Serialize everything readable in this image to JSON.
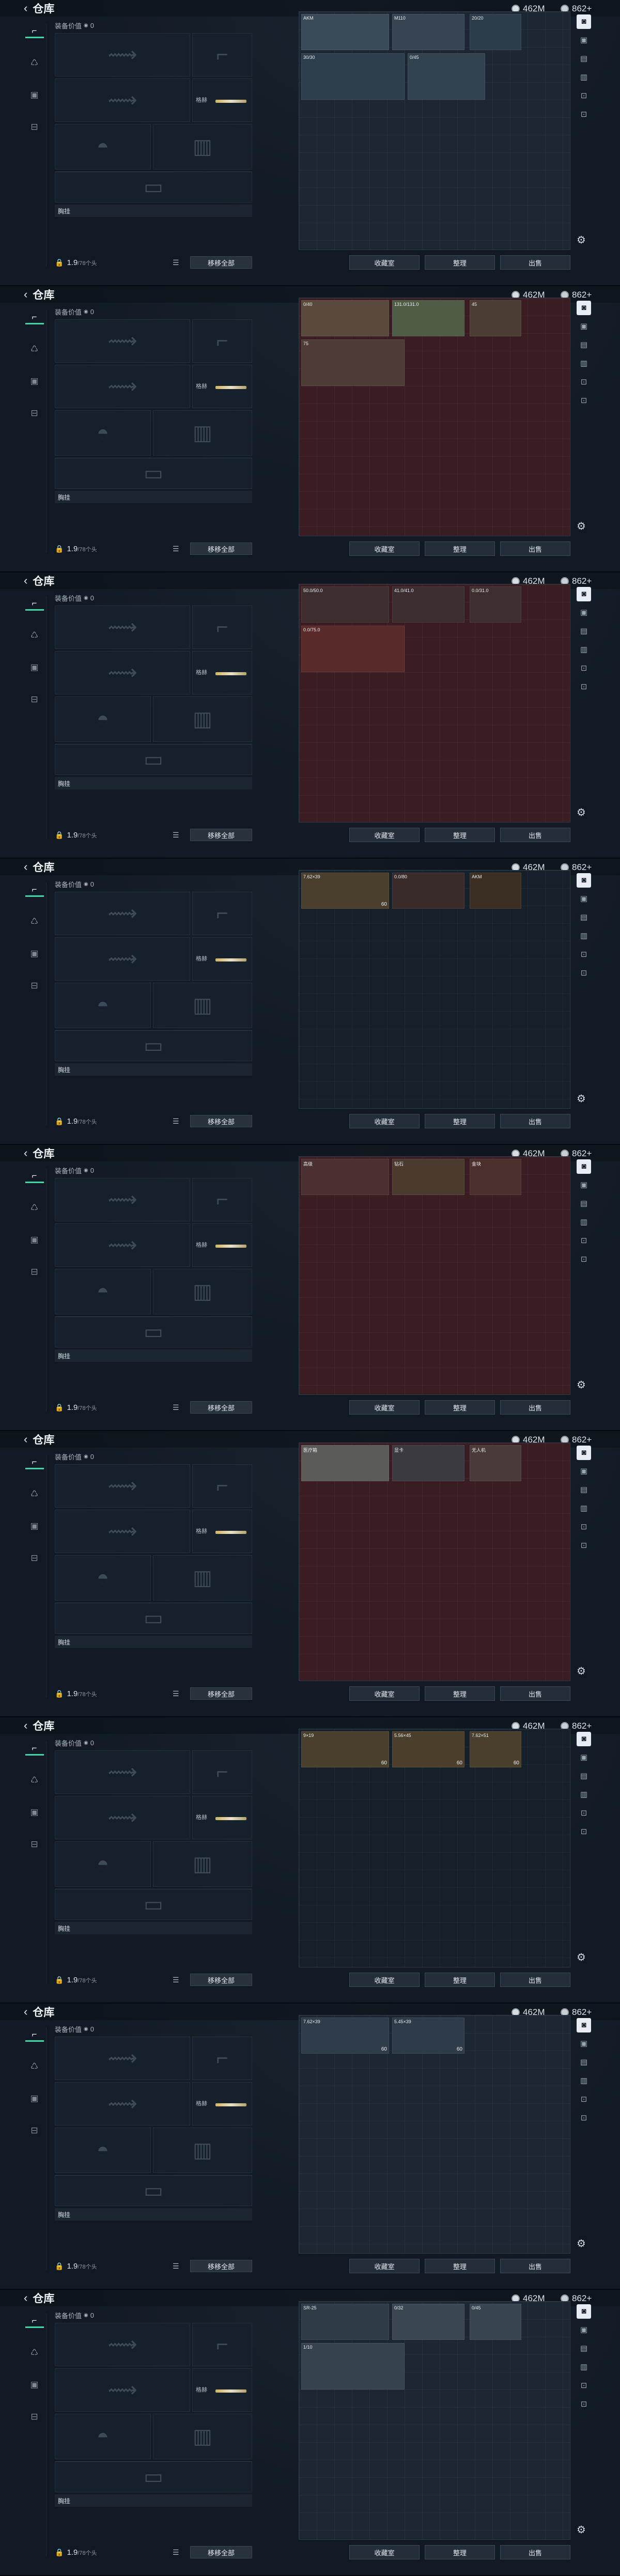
{
  "page": {
    "back_icon": "back-arrow-icon",
    "title": "仓库",
    "currency": [
      {
        "icon": "coin-icon",
        "value": "462M"
      },
      {
        "icon": "silver-icon",
        "value": "862+"
      }
    ],
    "loadout": {
      "equip_value_label": "装备价值",
      "equip_value": "0",
      "knife_label": "格赫",
      "pocket_label": "胸挂",
      "capacity_value": "1.9",
      "capacity_total": "/78个头",
      "remove_all_label": "移移全部"
    },
    "actions": [
      "收藏室",
      "整理",
      "出售"
    ],
    "hint": "收藏室"
  },
  "frames": [
    {
      "theme": "blue",
      "items": [
        {
          "label": "AKM",
          "count": "",
          "color": "#3a4a58"
        },
        {
          "label": "M110",
          "count": "",
          "color": "#374553"
        },
        {
          "label": "20/20",
          "count": "",
          "color": "#2c3c4a"
        },
        {
          "label": "30/30",
          "count": "",
          "color": "#2e3e4c"
        },
        {
          "label": "0/45",
          "count": "",
          "color": "#33424f"
        }
      ]
    },
    {
      "theme": "red",
      "items": [
        {
          "label": "0/40",
          "count": "",
          "color": "#5a4a3d"
        },
        {
          "label": "131.0/131.0",
          "count": "",
          "color": "#4e5b45"
        },
        {
          "label": "45",
          "count": "",
          "color": "#4b3c34"
        },
        {
          "label": "75",
          "count": "",
          "color": "#4d3b35"
        }
      ]
    },
    {
      "theme": "red",
      "items": [
        {
          "label": "50.0/50.0",
          "count": "",
          "color": "#3e2d2f"
        },
        {
          "label": "41.0/41.0",
          "count": "",
          "color": "#3c2d30"
        },
        {
          "label": "0.0/31.0",
          "count": "",
          "color": "#3f2e30"
        },
        {
          "label": "0.0/75.0",
          "count": "",
          "color": "#5a2a2a"
        }
      ]
    },
    {
      "theme": "dark",
      "items": [
        {
          "label": "7.62×39",
          "count": "60",
          "color": "#4a3f2c"
        },
        {
          "label": "0.0/80",
          "count": "",
          "color": "#3a2b2b"
        },
        {
          "label": "AKM",
          "count": "",
          "color": "#3b2f24"
        }
      ]
    },
    {
      "theme": "red",
      "items": [
        {
          "label": "高级",
          "count": "",
          "color": "#4a3030"
        },
        {
          "label": "钻石",
          "count": "",
          "color": "#4b3b2e"
        },
        {
          "label": "金块",
          "count": "",
          "color": "#4a2f2c"
        }
      ]
    },
    {
      "theme": "red",
      "items": [
        {
          "label": "医疗箱",
          "count": "",
          "color": "#5a5a58"
        },
        {
          "label": "显卡",
          "count": "",
          "color": "#3b3a40"
        },
        {
          "label": "无人机",
          "count": "",
          "color": "#4a3a3a"
        }
      ]
    },
    {
      "theme": "dark",
      "items": [
        {
          "label": "9×19",
          "count": "60",
          "color": "#4a3f2c"
        },
        {
          "label": "5.56×45",
          "count": "60",
          "color": "#4b3e2b"
        },
        {
          "label": "7.62×51",
          "count": "60",
          "color": "#4a3e2c"
        }
      ]
    },
    {
      "theme": "blue",
      "items": [
        {
          "label": "7.62×39",
          "count": "60",
          "color": "#2f3c49"
        },
        {
          "label": "5.45×39",
          "count": "60",
          "color": "#2e3b48"
        }
      ]
    },
    {
      "theme": "blue",
      "items": [
        {
          "label": "SR-25",
          "count": "",
          "color": "#2f3b47"
        },
        {
          "label": "0/32",
          "count": "",
          "color": "#3a4652"
        },
        {
          "label": "0/45",
          "count": "",
          "color": "#384450"
        },
        {
          "label": "1/10",
          "count": "",
          "color": "#36424e"
        }
      ]
    }
  ]
}
